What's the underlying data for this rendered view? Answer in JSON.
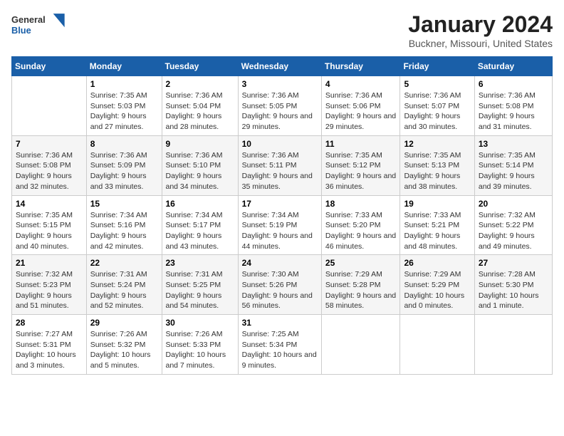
{
  "logo": {
    "line1": "General",
    "line2": "Blue"
  },
  "title": "January 2024",
  "subtitle": "Buckner, Missouri, United States",
  "days_header": [
    "Sunday",
    "Monday",
    "Tuesday",
    "Wednesday",
    "Thursday",
    "Friday",
    "Saturday"
  ],
  "weeks": [
    [
      {
        "day": "",
        "sunrise": "",
        "sunset": "",
        "daylight": ""
      },
      {
        "day": "1",
        "sunrise": "Sunrise: 7:35 AM",
        "sunset": "Sunset: 5:03 PM",
        "daylight": "Daylight: 9 hours and 27 minutes."
      },
      {
        "day": "2",
        "sunrise": "Sunrise: 7:36 AM",
        "sunset": "Sunset: 5:04 PM",
        "daylight": "Daylight: 9 hours and 28 minutes."
      },
      {
        "day": "3",
        "sunrise": "Sunrise: 7:36 AM",
        "sunset": "Sunset: 5:05 PM",
        "daylight": "Daylight: 9 hours and 29 minutes."
      },
      {
        "day": "4",
        "sunrise": "Sunrise: 7:36 AM",
        "sunset": "Sunset: 5:06 PM",
        "daylight": "Daylight: 9 hours and 29 minutes."
      },
      {
        "day": "5",
        "sunrise": "Sunrise: 7:36 AM",
        "sunset": "Sunset: 5:07 PM",
        "daylight": "Daylight: 9 hours and 30 minutes."
      },
      {
        "day": "6",
        "sunrise": "Sunrise: 7:36 AM",
        "sunset": "Sunset: 5:08 PM",
        "daylight": "Daylight: 9 hours and 31 minutes."
      }
    ],
    [
      {
        "day": "7",
        "sunrise": "Sunrise: 7:36 AM",
        "sunset": "Sunset: 5:08 PM",
        "daylight": "Daylight: 9 hours and 32 minutes."
      },
      {
        "day": "8",
        "sunrise": "Sunrise: 7:36 AM",
        "sunset": "Sunset: 5:09 PM",
        "daylight": "Daylight: 9 hours and 33 minutes."
      },
      {
        "day": "9",
        "sunrise": "Sunrise: 7:36 AM",
        "sunset": "Sunset: 5:10 PM",
        "daylight": "Daylight: 9 hours and 34 minutes."
      },
      {
        "day": "10",
        "sunrise": "Sunrise: 7:36 AM",
        "sunset": "Sunset: 5:11 PM",
        "daylight": "Daylight: 9 hours and 35 minutes."
      },
      {
        "day": "11",
        "sunrise": "Sunrise: 7:35 AM",
        "sunset": "Sunset: 5:12 PM",
        "daylight": "Daylight: 9 hours and 36 minutes."
      },
      {
        "day": "12",
        "sunrise": "Sunrise: 7:35 AM",
        "sunset": "Sunset: 5:13 PM",
        "daylight": "Daylight: 9 hours and 38 minutes."
      },
      {
        "day": "13",
        "sunrise": "Sunrise: 7:35 AM",
        "sunset": "Sunset: 5:14 PM",
        "daylight": "Daylight: 9 hours and 39 minutes."
      }
    ],
    [
      {
        "day": "14",
        "sunrise": "Sunrise: 7:35 AM",
        "sunset": "Sunset: 5:15 PM",
        "daylight": "Daylight: 9 hours and 40 minutes."
      },
      {
        "day": "15",
        "sunrise": "Sunrise: 7:34 AM",
        "sunset": "Sunset: 5:16 PM",
        "daylight": "Daylight: 9 hours and 42 minutes."
      },
      {
        "day": "16",
        "sunrise": "Sunrise: 7:34 AM",
        "sunset": "Sunset: 5:17 PM",
        "daylight": "Daylight: 9 hours and 43 minutes."
      },
      {
        "day": "17",
        "sunrise": "Sunrise: 7:34 AM",
        "sunset": "Sunset: 5:19 PM",
        "daylight": "Daylight: 9 hours and 44 minutes."
      },
      {
        "day": "18",
        "sunrise": "Sunrise: 7:33 AM",
        "sunset": "Sunset: 5:20 PM",
        "daylight": "Daylight: 9 hours and 46 minutes."
      },
      {
        "day": "19",
        "sunrise": "Sunrise: 7:33 AM",
        "sunset": "Sunset: 5:21 PM",
        "daylight": "Daylight: 9 hours and 48 minutes."
      },
      {
        "day": "20",
        "sunrise": "Sunrise: 7:32 AM",
        "sunset": "Sunset: 5:22 PM",
        "daylight": "Daylight: 9 hours and 49 minutes."
      }
    ],
    [
      {
        "day": "21",
        "sunrise": "Sunrise: 7:32 AM",
        "sunset": "Sunset: 5:23 PM",
        "daylight": "Daylight: 9 hours and 51 minutes."
      },
      {
        "day": "22",
        "sunrise": "Sunrise: 7:31 AM",
        "sunset": "Sunset: 5:24 PM",
        "daylight": "Daylight: 9 hours and 52 minutes."
      },
      {
        "day": "23",
        "sunrise": "Sunrise: 7:31 AM",
        "sunset": "Sunset: 5:25 PM",
        "daylight": "Daylight: 9 hours and 54 minutes."
      },
      {
        "day": "24",
        "sunrise": "Sunrise: 7:30 AM",
        "sunset": "Sunset: 5:26 PM",
        "daylight": "Daylight: 9 hours and 56 minutes."
      },
      {
        "day": "25",
        "sunrise": "Sunrise: 7:29 AM",
        "sunset": "Sunset: 5:28 PM",
        "daylight": "Daylight: 9 hours and 58 minutes."
      },
      {
        "day": "26",
        "sunrise": "Sunrise: 7:29 AM",
        "sunset": "Sunset: 5:29 PM",
        "daylight": "Daylight: 10 hours and 0 minutes."
      },
      {
        "day": "27",
        "sunrise": "Sunrise: 7:28 AM",
        "sunset": "Sunset: 5:30 PM",
        "daylight": "Daylight: 10 hours and 1 minute."
      }
    ],
    [
      {
        "day": "28",
        "sunrise": "Sunrise: 7:27 AM",
        "sunset": "Sunset: 5:31 PM",
        "daylight": "Daylight: 10 hours and 3 minutes."
      },
      {
        "day": "29",
        "sunrise": "Sunrise: 7:26 AM",
        "sunset": "Sunset: 5:32 PM",
        "daylight": "Daylight: 10 hours and 5 minutes."
      },
      {
        "day": "30",
        "sunrise": "Sunrise: 7:26 AM",
        "sunset": "Sunset: 5:33 PM",
        "daylight": "Daylight: 10 hours and 7 minutes."
      },
      {
        "day": "31",
        "sunrise": "Sunrise: 7:25 AM",
        "sunset": "Sunset: 5:34 PM",
        "daylight": "Daylight: 10 hours and 9 minutes."
      },
      {
        "day": "",
        "sunrise": "",
        "sunset": "",
        "daylight": ""
      },
      {
        "day": "",
        "sunrise": "",
        "sunset": "",
        "daylight": ""
      },
      {
        "day": "",
        "sunrise": "",
        "sunset": "",
        "daylight": ""
      }
    ]
  ]
}
